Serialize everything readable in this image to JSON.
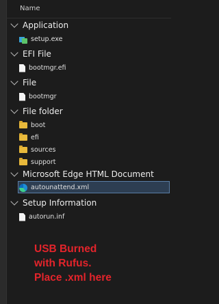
{
  "header": {
    "column_name": "Name"
  },
  "groups": [
    {
      "label": "Application",
      "items": [
        {
          "name": "setup.exe",
          "icon": "exe-icon"
        }
      ]
    },
    {
      "label": "EFI File",
      "items": [
        {
          "name": "bootmgr.efi",
          "icon": "file-icon"
        }
      ]
    },
    {
      "label": "File",
      "items": [
        {
          "name": "bootmgr",
          "icon": "file-icon"
        }
      ]
    },
    {
      "label": "File folder",
      "items": [
        {
          "name": "boot",
          "icon": "folder-icon"
        },
        {
          "name": "efi",
          "icon": "folder-icon"
        },
        {
          "name": "sources",
          "icon": "folder-icon"
        },
        {
          "name": "support",
          "icon": "folder-icon"
        }
      ]
    },
    {
      "label": "Microsoft Edge HTML Document",
      "items": [
        {
          "name": "autounattend.xml",
          "icon": "edge-icon",
          "selected": true
        }
      ]
    },
    {
      "label": "Setup Information",
      "items": [
        {
          "name": "autorun.inf",
          "icon": "file-icon"
        }
      ]
    }
  ],
  "annotation": {
    "line1": "USB Burned",
    "line2": "with Rufus.",
    "line3": "Place .xml here",
    "color": "#e3242b"
  }
}
